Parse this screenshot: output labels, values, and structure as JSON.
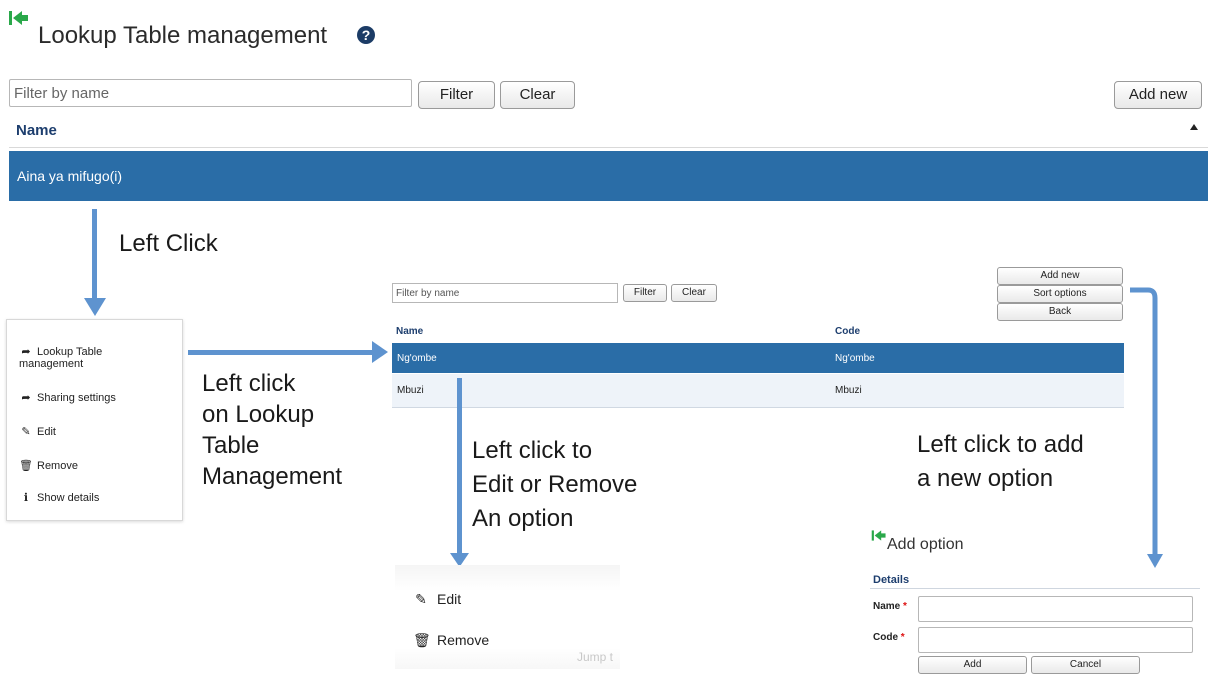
{
  "header": {
    "title": "Lookup Table management"
  },
  "toolbar": {
    "filter_placeholder": "Filter by name",
    "filter_label": "Filter",
    "clear_label": "Clear",
    "add_new_label": "Add new"
  },
  "list": {
    "column_name": "Name",
    "rows": [
      {
        "name": "Aina ya mifugo(i)"
      }
    ]
  },
  "annotations": {
    "left_click": "Left Click",
    "left_click_lookup": [
      "Left click",
      "on Lookup",
      "Table",
      "Management"
    ],
    "edit_remove": [
      "Left click to",
      "Edit or Remove",
      "An option"
    ],
    "add_option": [
      "Left click to add",
      "a new option"
    ]
  },
  "context_menu": {
    "items": [
      {
        "label_lines": [
          "Lookup Table",
          "management"
        ],
        "icon": "share-arrow-icon"
      },
      {
        "label": "Sharing settings",
        "icon": "share-arrow-icon"
      },
      {
        "label": "Edit",
        "icon": "edit-icon"
      },
      {
        "label": "Remove",
        "icon": "trash-icon"
      },
      {
        "label": "Show details",
        "icon": "info-icon"
      }
    ]
  },
  "options_screen": {
    "filter_placeholder": "Filter by name",
    "filter_label": "Filter",
    "clear_label": "Clear",
    "add_new_label": "Add new",
    "sort_options_label": "Sort options",
    "back_label": "Back",
    "column_name": "Name",
    "column_code": "Code",
    "rows": [
      {
        "name": "Ng'ombe",
        "code": "Ng'ombe"
      },
      {
        "name": "Mbuzi",
        "code": "Mbuzi"
      }
    ]
  },
  "option_menu": {
    "items": [
      {
        "label": "Edit",
        "icon": "edit-icon"
      },
      {
        "label": "Remove",
        "icon": "trash-icon"
      }
    ],
    "ghost_text": "Jump t"
  },
  "add_option": {
    "title": "Add option",
    "section": "Details",
    "name_label": "Name",
    "code_label": "Code",
    "required_mark": "*",
    "add_label": "Add",
    "cancel_label": "Cancel"
  },
  "colors": {
    "selected_row": "#2a6da7",
    "arrow": "#5e93cf",
    "header_text": "#1d3e6e",
    "back_icon": "#2aa84a"
  }
}
